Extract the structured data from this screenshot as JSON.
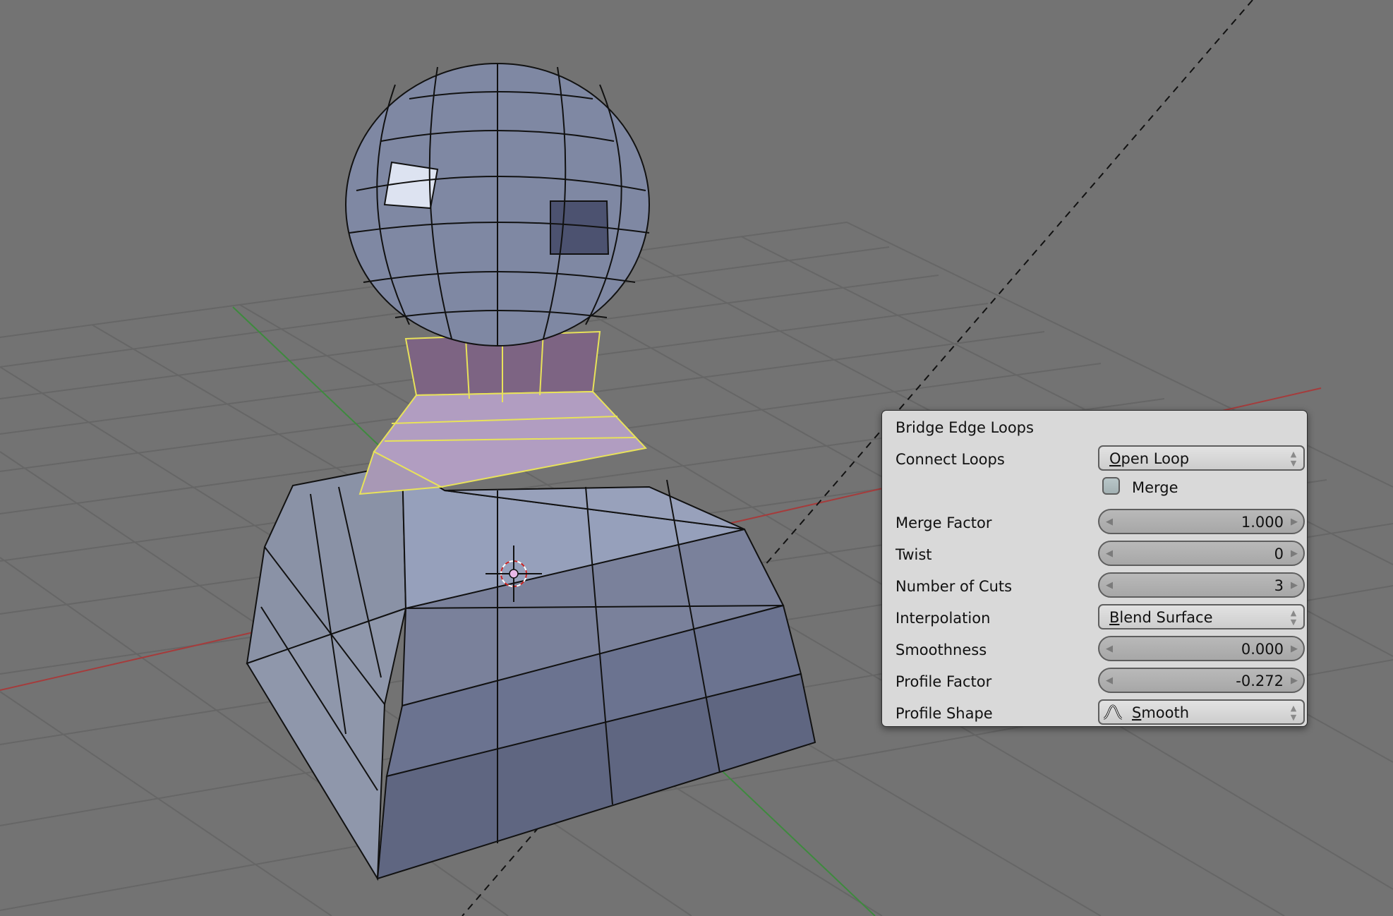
{
  "app": "Blender",
  "mode": "Edit Mode",
  "viewport": {
    "background_color": "#737373",
    "grid_color": "#636363",
    "x_axis_color": "#a53c3c",
    "y_axis_color": "#3e8a3e",
    "mesh_face_color": "#8f97b1",
    "selected_face_color": "#b19dc1",
    "selected_edge_color": "#e8e25a",
    "vertex_color": "#e070e0",
    "icons": [
      "3d-cursor-icon"
    ]
  },
  "operator_panel": {
    "title": "Bridge Edge Loops",
    "fields": {
      "connect_loops": {
        "label": "Connect Loops",
        "value_mnemonic": "O",
        "value_rest": "pen Loop",
        "value": "Open Loop"
      },
      "merge": {
        "label": "Merge",
        "checked": false
      },
      "merge_factor": {
        "label": "Merge Factor",
        "value": "1.000"
      },
      "twist": {
        "label": "Twist",
        "value": "0"
      },
      "number_of_cuts": {
        "label": "Number of Cuts",
        "value": "3"
      },
      "interpolation": {
        "label": "Interpolation",
        "value_mnemonic": "B",
        "value_rest": "lend Surface",
        "value": "Blend Surface"
      },
      "smoothness": {
        "label": "Smoothness",
        "value": "0.000"
      },
      "profile_factor": {
        "label": "Profile Factor",
        "value": "-0.272"
      },
      "profile_shape": {
        "label": "Profile Shape",
        "value_mnemonic": "S",
        "value_rest": "mooth",
        "value": "Smooth",
        "icon": "smooth-falloff-icon"
      }
    },
    "glyphs": {
      "arrow_left": "◀",
      "arrow_right": "▶",
      "arrow_up": "▲",
      "arrow_down": "▼"
    }
  }
}
